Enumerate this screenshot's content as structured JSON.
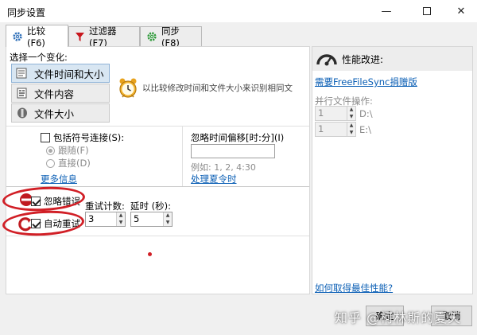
{
  "window": {
    "title": "同步设置",
    "minimize": "—",
    "close": "✕"
  },
  "tabs": [
    {
      "label": "比较 (F6)",
      "icon": "gear-icon"
    },
    {
      "label": "过滤器 (F7)",
      "icon": "filter-icon"
    },
    {
      "label": "同步 (F8)",
      "icon": "sync-gear-icon"
    }
  ],
  "compare": {
    "section_label": "选择一个变化:",
    "options": [
      {
        "label": "文件时间和大小",
        "icon": "clock-icon",
        "selected": true
      },
      {
        "label": "文件内容",
        "icon": "file-content-icon",
        "selected": false
      },
      {
        "label": "文件大小",
        "icon": "file-size-icon",
        "selected": false
      }
    ],
    "description": "以比较修改时间和文件大小来识别相同文"
  },
  "symlinks": {
    "label": "包括符号连接(S):",
    "checked": false,
    "follow": "跟随(F)",
    "direct": "直接(D)",
    "more_info": "更多信息"
  },
  "time_shift": {
    "label": "忽略时间偏移[时:分](I)",
    "value": "",
    "example": "例如: 1, 2, 4:30",
    "dst_link": "处理夏令时"
  },
  "errors": {
    "ignore_label": "忽略错误",
    "ignore_checked": true,
    "auto_retry_label": "自动重试",
    "auto_retry_checked": true,
    "retry_count_label": "重试计数:",
    "retry_count_value": "3",
    "delay_label": "延时 (秒):",
    "delay_value": "5"
  },
  "performance": {
    "title": "性能改进:",
    "donation_link": "需要FreeFileSync捐赠版",
    "parallel_label": "并行文件操作:",
    "rows": [
      {
        "value": "1",
        "drive": "D:\\"
      },
      {
        "value": "1",
        "drive": "E:\\"
      }
    ],
    "best_perf_link": "如何取得最佳性能?"
  },
  "buttons": {
    "ok": "确定",
    "cancel": "取消"
  },
  "watermark": "知乎 @柯林斯的夏天",
  "colors": {
    "accent_red": "#d11f26",
    "link_blue": "#0b5fb5",
    "selected_bg": "#d8e6f2"
  }
}
